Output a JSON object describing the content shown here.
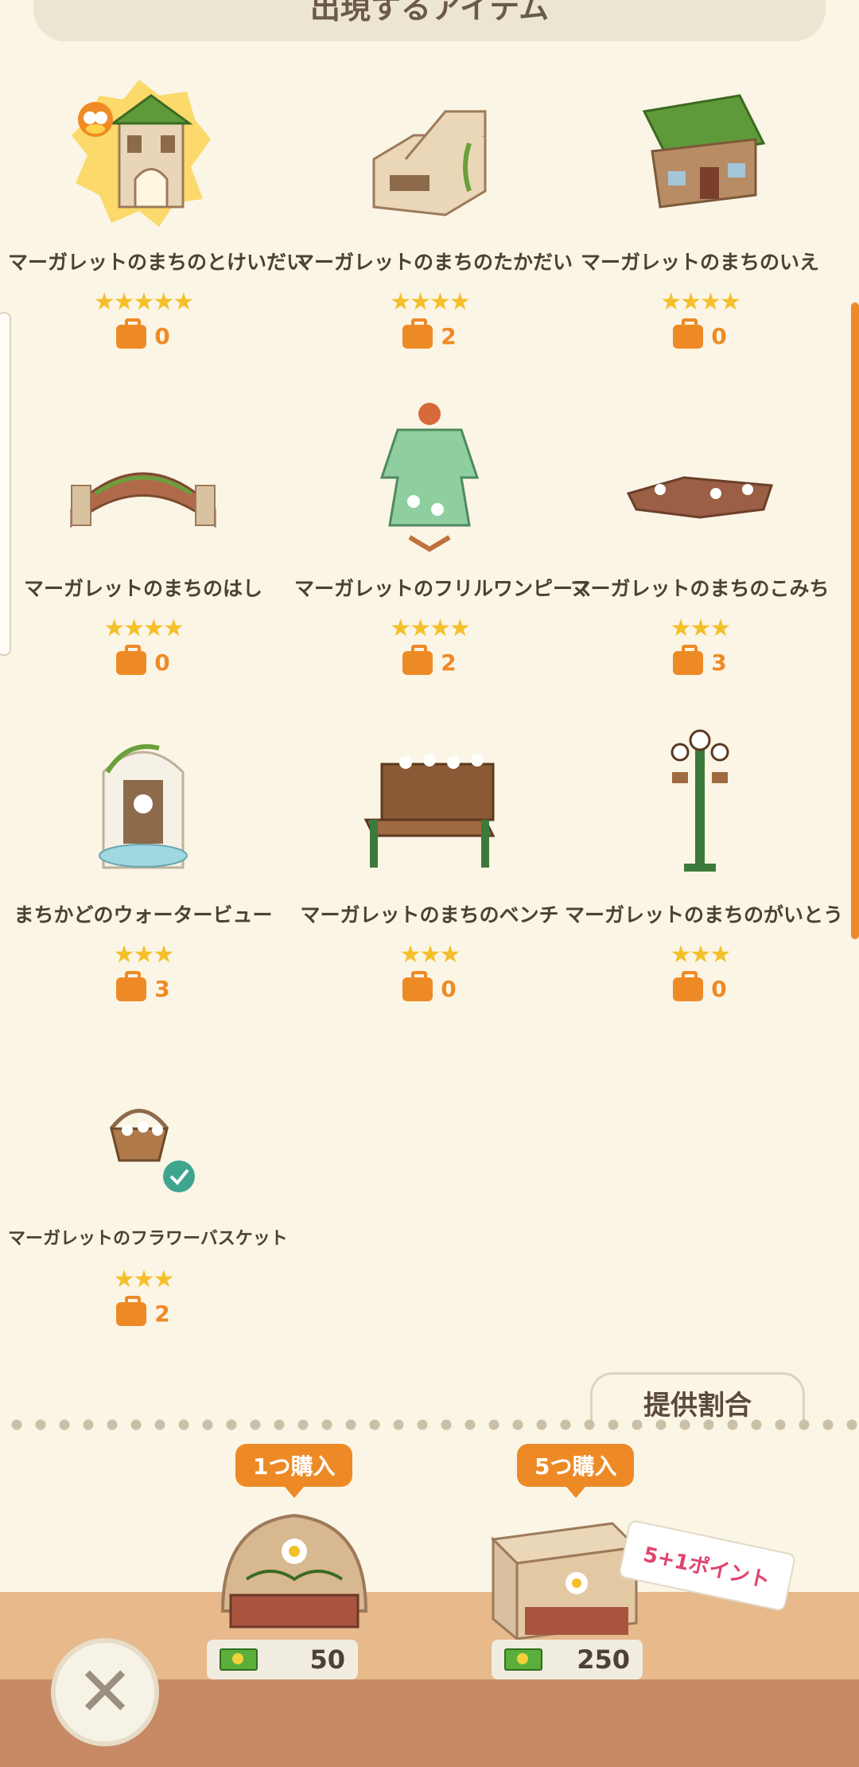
{
  "header": {
    "title": "出現するアイテム"
  },
  "items": [
    {
      "name": "マーガレットのまちのとけいだい",
      "stars": "★★★★★",
      "owned": "0"
    },
    {
      "name": "マーガレットのまちのたかだい",
      "stars": "★★★★",
      "owned": "2"
    },
    {
      "name": "マーガレットのまちのいえ",
      "stars": "★★★★",
      "owned": "0"
    },
    {
      "name": "マーガレットのまちのはし",
      "stars": "★★★★",
      "owned": "0"
    },
    {
      "name": "マーガレットのフリルワンピース",
      "stars": "★★★★",
      "owned": "2"
    },
    {
      "name": "マーガレットのまちのこみち",
      "stars": "★★★",
      "owned": "3"
    },
    {
      "name": "まちかどのウォータービュー",
      "stars": "★★★",
      "owned": "3"
    },
    {
      "name": "マーガレットのまちのベンチ",
      "stars": "★★★",
      "owned": "0"
    },
    {
      "name": "マーガレットのまちのがいとう",
      "stars": "★★★",
      "owned": "0"
    },
    {
      "name": "マーガレットのフラワーバスケット",
      "stars": "★★★",
      "owned": "2"
    }
  ],
  "rate_tab": {
    "label": "提供割合"
  },
  "purchase": {
    "single": {
      "label": "1つ購入",
      "price": "50"
    },
    "five": {
      "label": "5つ購入",
      "price": "250",
      "bonus": "5+1ポイント"
    }
  },
  "colors": {
    "accent": "#ee8a25",
    "star": "#f4c02a",
    "background": "#fbf5e6"
  }
}
